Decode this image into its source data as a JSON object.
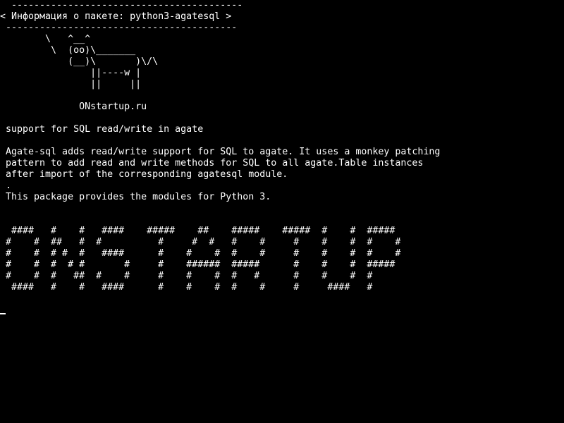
{
  "terminal": {
    "lines": [
      "  -----------------------------------------",
      "< Информация о пакете: python3-agatesql >",
      " -----------------------------------------",
      "        \\   ^__^",
      "         \\  (oo)\\_______",
      "            (__)\\       )\\/\\",
      "                ||----w |",
      "                ||     ||",
      "",
      "              ONstartup.ru",
      "",
      " support for SQL read/write in agate",
      "",
      " Agate-sql adds read/write support for SQL to agate. It uses a monkey patching",
      " pattern to add read and write methods for SQL to all agate.Table instances",
      " after import of the corresponding agatesql module.",
      " .",
      " This package provides the modules for Python 3.",
      "",
      "",
      "  ####   #    #   ####    #####    ##    #####    #####  #    #  #####",
      " #    #  ##   #  #          #     #  #   #    #     #    #    #  #    #",
      " #    #  # #  #   ####      #    #    #  #    #     #    #    #  #    #",
      " #    #  #  # #       #     #    ######  #####      #    #    #  #####",
      " #    #  #   ##  #    #     #    #    #  #   #      #    #    #  #",
      "  ####   #    #   ####      #    #    #  #    #     #     ####   #"
    ],
    "cursor": "_"
  }
}
